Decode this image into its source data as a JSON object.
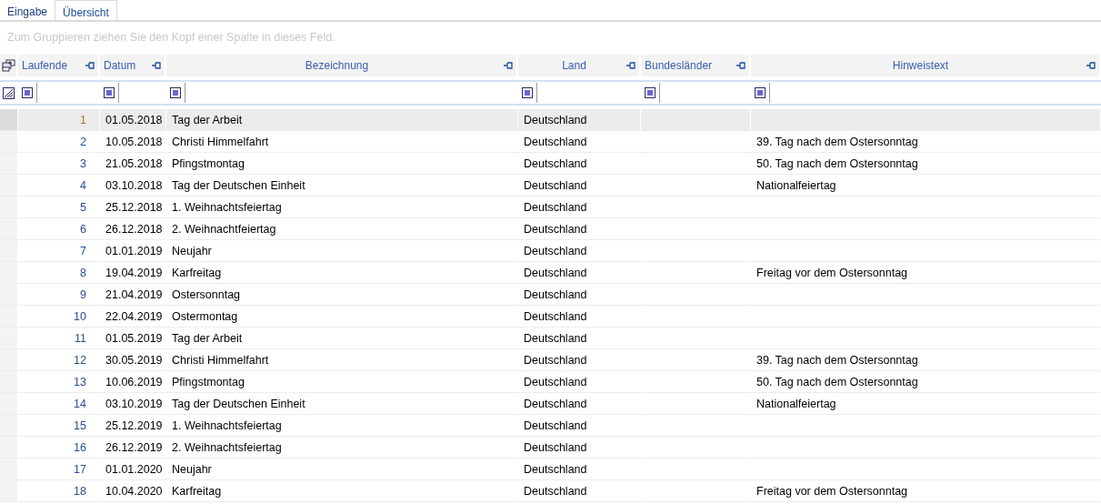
{
  "tabs": [
    {
      "label": "Eingabe",
      "selected": false
    },
    {
      "label": "Übersicht",
      "selected": true
    }
  ],
  "group_hint": "Zum Gruppieren ziehen Sie den Kopf einer Spalte in dieses Feld.",
  "columns": [
    {
      "label": "Laufende"
    },
    {
      "label": "Datum"
    },
    {
      "label": "Bezeichnung"
    },
    {
      "label": "Land"
    },
    {
      "label": "Bundesländer"
    },
    {
      "label": "Hinweistext"
    }
  ],
  "rows": [
    {
      "selected": true,
      "cells": [
        "1",
        "01.05.2018",
        "Tag der Arbeit",
        "Deutschland",
        "",
        ""
      ]
    },
    {
      "selected": false,
      "cells": [
        "2",
        "10.05.2018",
        "Christi Himmelfahrt",
        "Deutschland",
        "",
        "39. Tag nach dem Ostersonntag"
      ]
    },
    {
      "selected": false,
      "cells": [
        "3",
        "21.05.2018",
        "Pfingstmontag",
        "Deutschland",
        "",
        "50. Tag nach dem Ostersonntag"
      ]
    },
    {
      "selected": false,
      "cells": [
        "4",
        "03.10.2018",
        "Tag der Deutschen Einheit",
        "Deutschland",
        "",
        "Nationalfeiertag"
      ]
    },
    {
      "selected": false,
      "cells": [
        "5",
        "25.12.2018",
        "1. Weihnachtsfeiertag",
        "Deutschland",
        "",
        ""
      ]
    },
    {
      "selected": false,
      "cells": [
        "6",
        "26.12.2018",
        "2. Weihnachtfeiertag",
        "Deutschland",
        "",
        ""
      ]
    },
    {
      "selected": false,
      "cells": [
        "7",
        "01.01.2019",
        "Neujahr",
        "Deutschland",
        "",
        ""
      ]
    },
    {
      "selected": false,
      "cells": [
        "8",
        "19.04.2019",
        "Karfreitag",
        "Deutschland",
        "",
        "Freitag vor dem Ostersonntag"
      ]
    },
    {
      "selected": false,
      "cells": [
        "9",
        "21.04.2019",
        "Ostersonntag",
        "Deutschland",
        "",
        ""
      ]
    },
    {
      "selected": false,
      "cells": [
        "10",
        "22.04.2019",
        "Ostermontag",
        "Deutschland",
        "",
        ""
      ]
    },
    {
      "selected": false,
      "cells": [
        "11",
        "01.05.2019",
        "Tag der Arbeit",
        "Deutschland",
        "",
        ""
      ]
    },
    {
      "selected": false,
      "cells": [
        "12",
        "30.05.2019",
        "Christi Himmelfahrt",
        "Deutschland",
        "",
        "39. Tag nach dem Ostersonntag"
      ]
    },
    {
      "selected": false,
      "cells": [
        "13",
        "10.06.2019",
        "Pfingstmontag",
        "Deutschland",
        "",
        "50. Tag nach dem Ostersonntag"
      ]
    },
    {
      "selected": false,
      "cells": [
        "14",
        "03.10.2019",
        "Tag der Deutschen Einheit",
        "Deutschland",
        "",
        "Nationalfeiertag"
      ]
    },
    {
      "selected": false,
      "cells": [
        "15",
        "25.12.2019",
        "1. Weihnachtsfeiertag",
        "Deutschland",
        "",
        ""
      ]
    },
    {
      "selected": false,
      "cells": [
        "16",
        "26.12.2019",
        "2. Weihnachtsfeiertag",
        "Deutschland",
        "",
        ""
      ]
    },
    {
      "selected": false,
      "cells": [
        "17",
        "01.01.2020",
        "Neujahr",
        "Deutschland",
        "",
        ""
      ]
    },
    {
      "selected": false,
      "cells": [
        "18",
        "10.04.2020",
        "Karfreitag",
        "Deutschland",
        "",
        "Freitag vor dem Ostersonntag"
      ]
    }
  ]
}
